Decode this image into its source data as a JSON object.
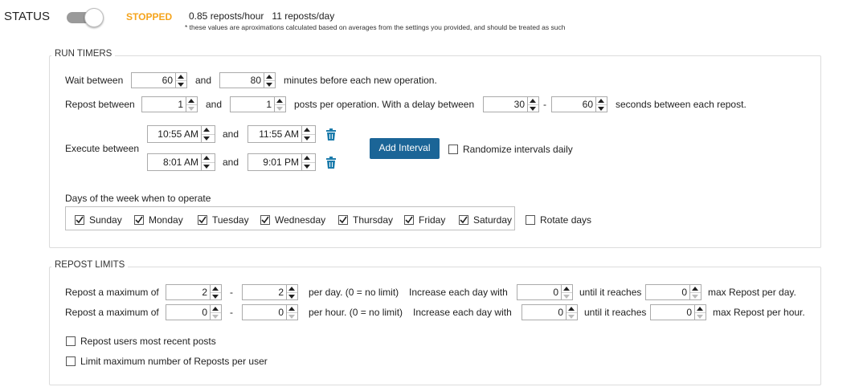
{
  "status": {
    "label": "STATUS",
    "state": "STOPPED",
    "state_color": "#f5a41c",
    "toggle_on": false,
    "reposts_hour": "0.85 reposts/hour",
    "reposts_day": "11 reposts/day",
    "note": "* these values are aproximations calculated based on averages from the settings you provided, and should be treated as such"
  },
  "run_timers": {
    "title": "RUN TIMERS",
    "wait": {
      "label": "Wait between",
      "min": "60",
      "and": "and",
      "max": "80",
      "suffix": "minutes before each new operation."
    },
    "repost": {
      "label": "Repost between",
      "min": "1",
      "and": "and",
      "max": "1",
      "middle": "posts per operation.  With a delay between",
      "delay_min": "30",
      "dash": "-",
      "delay_max": "60",
      "suffix": "seconds between each repost."
    },
    "execute": {
      "label": "Execute between",
      "intervals": [
        {
          "start": "10:55 AM",
          "and": "and",
          "end": "11:55 AM"
        },
        {
          "start": "8:01 AM",
          "and": "and",
          "end": "9:01 PM"
        }
      ],
      "add_interval": "Add Interval",
      "randomize": {
        "label": "Randomize intervals daily",
        "checked": false
      }
    },
    "days_label": "Days of the week when to operate",
    "days": [
      {
        "label": "Sunday",
        "checked": true
      },
      {
        "label": "Monday",
        "checked": true
      },
      {
        "label": "Tuesday",
        "checked": true
      },
      {
        "label": "Wednesday",
        "checked": true
      },
      {
        "label": "Thursday",
        "checked": true
      },
      {
        "label": "Friday",
        "checked": true
      },
      {
        "label": "Saturday",
        "checked": true
      }
    ],
    "rotate_days": {
      "label": "Rotate days",
      "checked": false
    }
  },
  "repost_limits": {
    "title": "REPOST LIMITS",
    "rows": [
      {
        "label": "Repost a maximum of",
        "min": "2",
        "dash": "-",
        "max": "2",
        "per": "per day. (0 = no limit)",
        "increase": "Increase each day with",
        "inc": "0",
        "until": "until it reaches",
        "cap": "0",
        "suffix": "max Repost per day."
      },
      {
        "label": "Repost a maximum of",
        "min": "0",
        "dash": "-",
        "max": "0",
        "per": "per hour. (0 = no limit)",
        "increase": "Increase each day with",
        "inc": "0",
        "until": "until it reaches",
        "cap": "0",
        "suffix": "max Repost per hour."
      }
    ],
    "recent_posts": {
      "label": "Repost users most recent posts",
      "checked": false
    },
    "limit_per_user": {
      "label": "Limit maximum number of Reposts per user",
      "checked": false
    }
  },
  "colors": {
    "accent": "#1b6597",
    "trash": "#1b7bab"
  }
}
